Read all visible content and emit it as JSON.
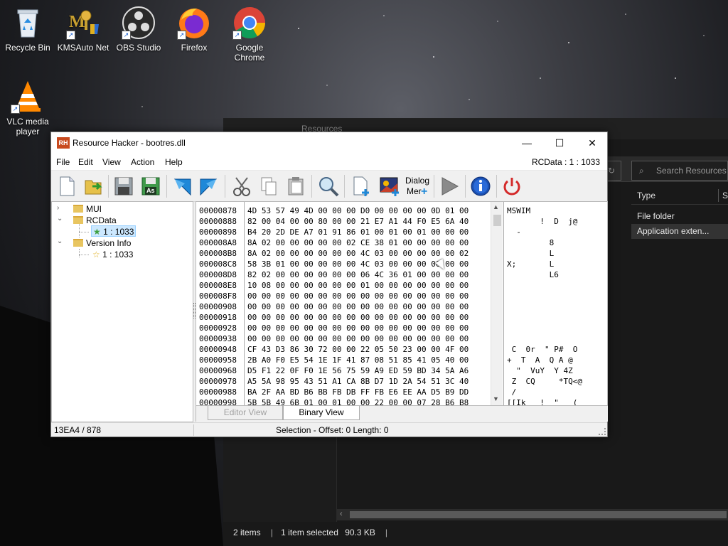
{
  "desktop": {
    "icons": [
      {
        "label": "Recycle Bin"
      },
      {
        "label": "KMSAuto Net"
      },
      {
        "label": "OBS Studio"
      },
      {
        "label": "Firefox"
      },
      {
        "label": "Google Chrome"
      },
      {
        "label": "VLC media player"
      }
    ]
  },
  "explorer": {
    "title": "Resources",
    "search_placeholder": "Search Resources",
    "columns": {
      "type": "Type",
      "size_short": "S"
    },
    "rows": [
      {
        "type": "File folder"
      },
      {
        "type": "Application exten..."
      }
    ],
    "status": {
      "items": "2 items",
      "selected": "1 item selected",
      "size": "90.3 KB"
    }
  },
  "rh": {
    "title": "Resource Hacker - bootres.dll",
    "logo": "RH",
    "resource_id": "RCData : 1 : 1033",
    "menu": [
      "File",
      "Edit",
      "View",
      "Action",
      "Help"
    ],
    "toolbar": {
      "dialog_label_1": "Dialog",
      "dialog_label_2": "Mer",
      "save_as": "As"
    },
    "tree": {
      "mui": "MUI",
      "rcdata": "RCData",
      "rcdata_child": "1 : 1033",
      "version_info": "Version Info",
      "version_child": "1 : 1033"
    },
    "hex": {
      "offsets": "00000878\n00000888\n00000898\n000008A8\n000008B8\n000008C8\n000008D8\n000008E8\n000008F8\n00000908\n00000918\n00000928\n00000938\n00000948\n00000958\n00000968\n00000978\n00000988\n00000998",
      "bytes": "4D 53 57 49 4D 00 00 00 D0 00 00 00 00 0D 01 00\n82 00 04 00 00 80 00 00 21 E7 A1 44 F0 E5 6A 40\nB4 20 2D DE A7 01 91 86 01 00 01 00 01 00 00 00\n8A 02 00 00 00 00 00 02 CE 38 01 00 00 00 00 00\n8A 02 00 00 00 00 00 00 4C 03 00 00 00 00 00 02\n58 3B 01 00 00 00 00 00 4C 03 00 00 00 00 00 00\n82 02 00 00 00 00 00 00 06 4C 36 01 00 00 00 00\n10 08 00 00 00 00 00 00 01 00 00 00 00 00 00 00\n00 00 00 00 00 00 00 00 00 00 00 00 00 00 00 00\n00 00 00 00 00 00 00 00 00 00 00 00 00 00 00 00\n00 00 00 00 00 00 00 00 00 00 00 00 00 00 00 00\n00 00 00 00 00 00 00 00 00 00 00 00 00 00 00 00\n00 00 00 00 00 00 00 00 00 00 00 00 00 00 00 00\nCF 43 D3 86 30 72 00 00 22 05 50 23 00 00 4F 00\n2B A0 F0 E5 54 1E 1F 41 87 08 51 85 41 05 40 00\nD5 F1 22 0F F0 1E 56 75 59 A9 ED 59 BD 34 5A A6\nA5 5A 98 95 43 51 A1 CA 8B D7 1D 2A 54 51 3C 40\nBA 2F AA BD B6 BB FB DB FF FB E6 EE AA D5 B9 DD\n5B 5B 49 6B 01 00 01 00 00 22 00 00 07 28 B6 B8",
      "ascii": "MSWIM\n       !  D  j@\n  -\n         8\n         L\nX;       L\n         L6\n\n\n\n\n\n\n C  0r  \" P#  O\n+  T  A  Q A @\n  \"  VuY  Y 4Z\n Z  CQ     *TQ<@\n /\n[[Ik   !  \"   ("
    },
    "tabs": {
      "editor": "Editor View",
      "binary": "Binary View"
    },
    "status": {
      "left": "13EA4 / 878",
      "right": "Selection - Offset: 0 Length: 0"
    }
  }
}
